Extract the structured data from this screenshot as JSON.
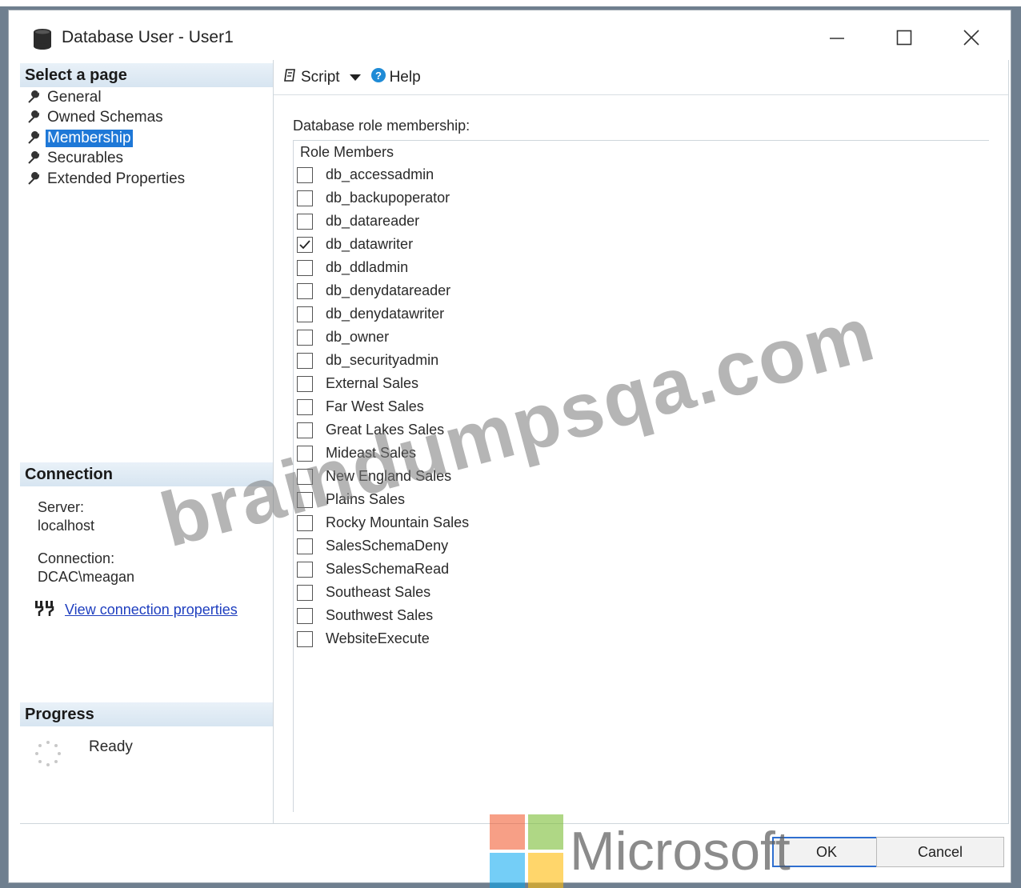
{
  "window": {
    "title": "Database User - User1"
  },
  "left": {
    "select_header": "Select a page",
    "pages": [
      {
        "label": "General"
      },
      {
        "label": "Owned Schemas"
      },
      {
        "label": "Membership",
        "selected": true
      },
      {
        "label": "Securables"
      },
      {
        "label": "Extended Properties"
      }
    ],
    "connection_header": "Connection",
    "server_label": "Server:",
    "server_value": "localhost",
    "connection_label": "Connection:",
    "connection_value": "DCAC\\meagan",
    "view_link": "View connection properties",
    "progress_header": "Progress",
    "progress_status": "Ready"
  },
  "toolbar": {
    "script_label": "Script",
    "help_label": "Help"
  },
  "main": {
    "heading": "Database role membership:",
    "column_header": "Role Members",
    "roles": [
      {
        "name": "db_accessadmin",
        "checked": false
      },
      {
        "name": "db_backupoperator",
        "checked": false
      },
      {
        "name": "db_datareader",
        "checked": false
      },
      {
        "name": "db_datawriter",
        "checked": true
      },
      {
        "name": "db_ddladmin",
        "checked": false
      },
      {
        "name": "db_denydatareader",
        "checked": false
      },
      {
        "name": "db_denydatawriter",
        "checked": false
      },
      {
        "name": "db_owner",
        "checked": false
      },
      {
        "name": "db_securityadmin",
        "checked": false
      },
      {
        "name": "External Sales",
        "checked": false
      },
      {
        "name": "Far West Sales",
        "checked": false
      },
      {
        "name": "Great Lakes Sales",
        "checked": false
      },
      {
        "name": "Mideast Sales",
        "checked": false
      },
      {
        "name": "New England Sales",
        "checked": false
      },
      {
        "name": "Plains Sales",
        "checked": false
      },
      {
        "name": "Rocky Mountain Sales",
        "checked": false
      },
      {
        "name": "SalesSchemaDeny",
        "checked": false
      },
      {
        "name": "SalesSchemaRead",
        "checked": false
      },
      {
        "name": "Southeast Sales",
        "checked": false
      },
      {
        "name": "Southwest Sales",
        "checked": false
      },
      {
        "name": "WebsiteExecute",
        "checked": false
      }
    ]
  },
  "footer": {
    "ok_label": "OK",
    "cancel_label": "Cancel"
  },
  "overlay": {
    "watermark": "braindumpsqa.com",
    "brand": "Microsoft"
  },
  "colors": {
    "accent": "#1e78d7",
    "link": "#1f3fbf",
    "header_bg": "#d7e5f1"
  }
}
